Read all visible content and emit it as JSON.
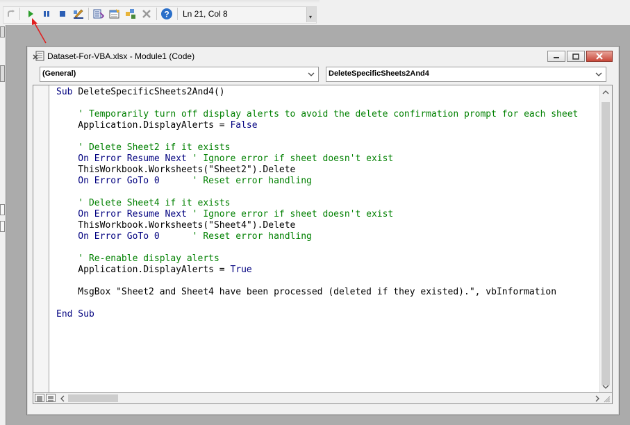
{
  "toolbar": {
    "cursor_position": "Ln 21, Col 8",
    "buttons": [
      "redo-icon",
      "run-icon",
      "break-icon",
      "reset-icon",
      "design-mode-icon",
      "project-explorer-icon",
      "properties-window-icon",
      "object-browser-icon",
      "toolbox-icon",
      "help-icon"
    ],
    "colors": {
      "run": "#2a9d2a",
      "pause": "#2c5fb5",
      "stop": "#2c5fb5",
      "help": "#2a6fc9"
    }
  },
  "window": {
    "title": "Dataset-For-VBA.xlsx - Module1 (Code)",
    "object_combo": "(General)",
    "procedure_combo": "DeleteSpecificSheets2And4"
  },
  "code": {
    "keyword_color": "#00007f",
    "comment_color": "#008000",
    "lines": [
      [
        {
          "t": "Sub ",
          "c": "kw"
        },
        {
          "t": "DeleteSpecificSheets2And4()",
          "c": "n"
        }
      ],
      [],
      [
        {
          "t": "    ' Temporarily turn off display alerts to avoid the delete confirmation prompt for each sheet",
          "c": "cm"
        }
      ],
      [
        {
          "t": "    Application.DisplayAlerts = ",
          "c": "n"
        },
        {
          "t": "False",
          "c": "kw"
        }
      ],
      [],
      [
        {
          "t": "    ' Delete Sheet2 if it exists",
          "c": "cm"
        }
      ],
      [
        {
          "t": "    On Error Resume Next ",
          "c": "kw"
        },
        {
          "t": "' Ignore error if sheet doesn't exist",
          "c": "cm"
        }
      ],
      [
        {
          "t": "    ThisWorkbook.Worksheets(\"Sheet2\").Delete",
          "c": "n"
        }
      ],
      [
        {
          "t": "    On Error GoTo 0",
          "c": "kw"
        },
        {
          "t": "      ' Reset error handling",
          "c": "cm"
        }
      ],
      [],
      [
        {
          "t": "    ' Delete Sheet4 if it exists",
          "c": "cm"
        }
      ],
      [
        {
          "t": "    On Error Resume Next ",
          "c": "kw"
        },
        {
          "t": "' Ignore error if sheet doesn't exist",
          "c": "cm"
        }
      ],
      [
        {
          "t": "    ThisWorkbook.Worksheets(\"Sheet4\").Delete",
          "c": "n"
        }
      ],
      [
        {
          "t": "    On Error GoTo 0",
          "c": "kw"
        },
        {
          "t": "      ' Reset error handling",
          "c": "cm"
        }
      ],
      [],
      [
        {
          "t": "    ' Re-enable display alerts",
          "c": "cm"
        }
      ],
      [
        {
          "t": "    Application.DisplayAlerts = ",
          "c": "n"
        },
        {
          "t": "True",
          "c": "kw"
        }
      ],
      [],
      [
        {
          "t": "    MsgBox \"Sheet2 and Sheet4 have been processed (deleted if they existed).\", vbInformation",
          "c": "n"
        }
      ],
      [],
      [
        {
          "t": "End Sub",
          "c": "kw"
        }
      ]
    ]
  },
  "annotation": {
    "color": "#e02020"
  }
}
